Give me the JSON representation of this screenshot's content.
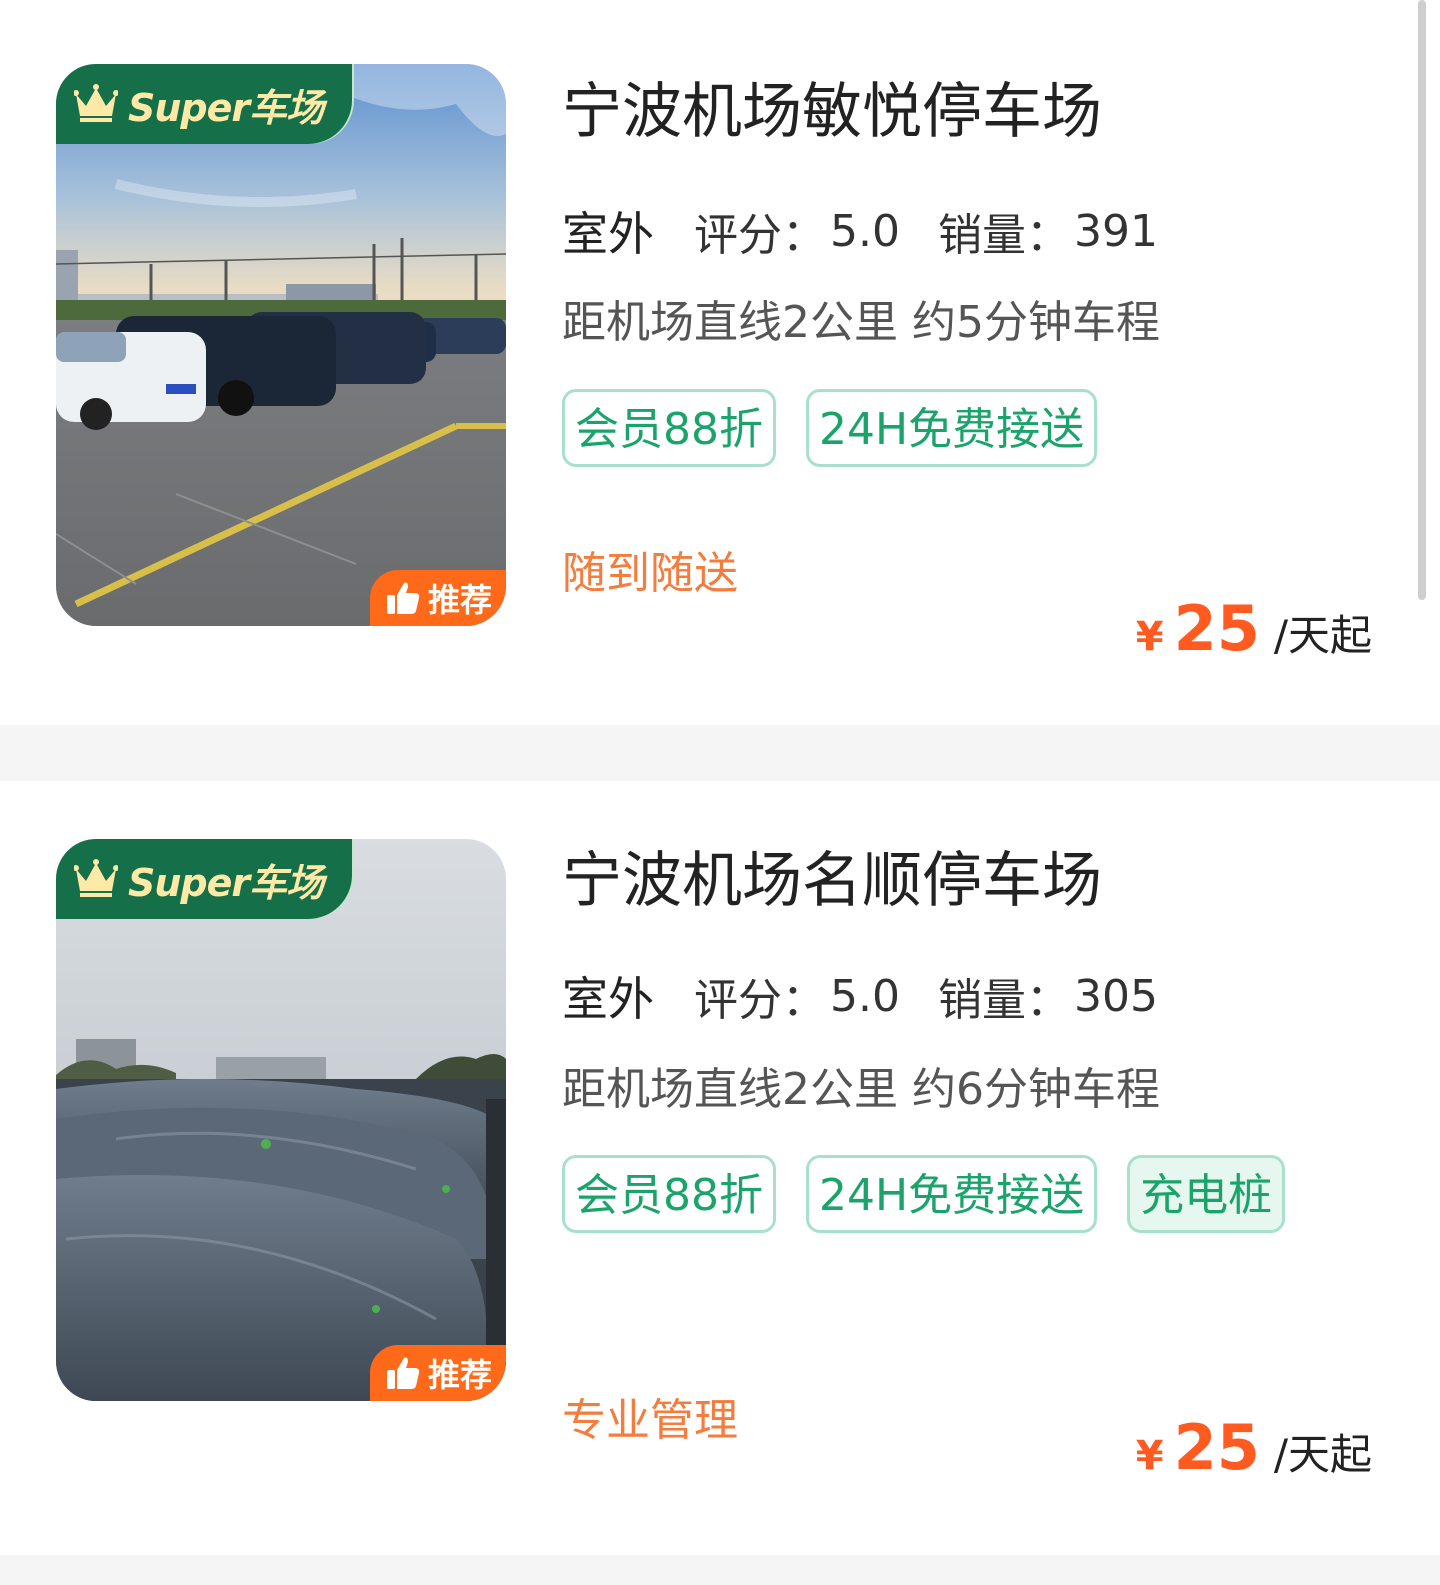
{
  "lots": [
    {
      "badge": "Super车场",
      "recommend": "推荐",
      "name": "宁波机场敏悦停车场",
      "type": "室外",
      "rating_label": "评分：",
      "rating": "5.0",
      "sales_label": "销量：",
      "sales": "391",
      "distance": "距机场直线2公里 约5分钟车程",
      "tags": [
        "会员88折",
        "24H免费接送"
      ],
      "highlight": "随到随送",
      "currency": "¥",
      "price": "25",
      "price_unit": "/天起"
    },
    {
      "badge": "Super车场",
      "recommend": "推荐",
      "name": "宁波机场名顺停车场",
      "type": "室外",
      "rating_label": "评分：",
      "rating": "5.0",
      "sales_label": "销量：",
      "sales": "305",
      "distance": "距机场直线2公里 约6分钟车程",
      "tags": [
        "会员88折",
        "24H免费接送"
      ],
      "extra_tag": "充电桩",
      "highlight": "专业管理",
      "currency": "¥",
      "price": "25",
      "price_unit": "/天起"
    }
  ],
  "colors": {
    "brand_green": "#15704a",
    "tag_green": "#1aa36b",
    "price_orange": "#ff5a1f",
    "highlight_orange": "#f47c3c",
    "recommend_orange": "#ff6a1a"
  }
}
